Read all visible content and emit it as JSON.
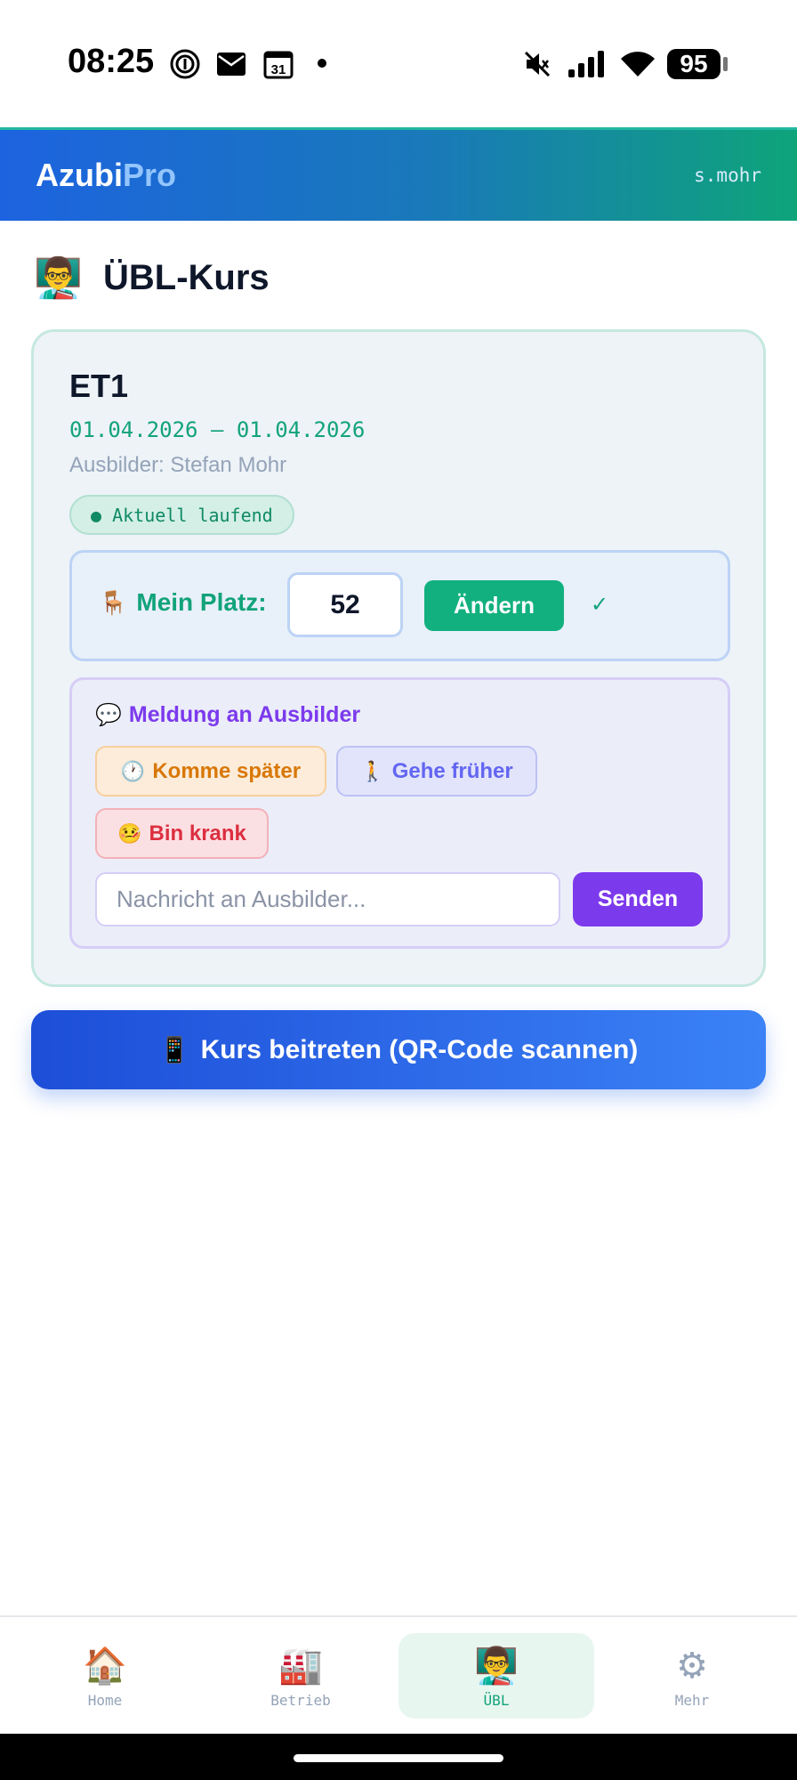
{
  "status_bar": {
    "time": "08:25",
    "calendar_day": "31",
    "battery": "95"
  },
  "header": {
    "brand_main": "Azubi",
    "brand_accent": "Pro",
    "username": "s.mohr"
  },
  "page": {
    "title_emoji": "👨‍🏫",
    "title": "ÜBL-Kurs"
  },
  "course": {
    "name": "ET1",
    "dates": "01.04.2026 – 01.04.2026",
    "trainer": "Ausbilder: Stefan Mohr",
    "status": "● Aktuell laufend",
    "seat": {
      "emoji": "🪑",
      "label": "Mein Platz:",
      "value": "52",
      "change_label": "Ändern",
      "check": "✓"
    },
    "message": {
      "emoji": "💬",
      "title": "Meldung an Ausbilder",
      "quick_late": {
        "emoji": "🕐",
        "label": "Komme später"
      },
      "quick_early": {
        "emoji": "🚶",
        "label": "Gehe früher"
      },
      "quick_sick": {
        "emoji": "🤒",
        "label": "Bin krank"
      },
      "placeholder": "Nachricht an Ausbilder...",
      "send_label": "Senden"
    }
  },
  "join": {
    "emoji": "📱",
    "label": "Kurs beitreten (QR-Code scannen)"
  },
  "nav": {
    "items": [
      {
        "emoji": "🏠",
        "label": "Home"
      },
      {
        "emoji": "🏭",
        "label": "Betrieb"
      },
      {
        "emoji": "👨‍🏫",
        "label": "ÜBL"
      },
      {
        "emoji": "⚙",
        "label": "Mehr"
      }
    ],
    "active": "ÜBL"
  },
  "colors": {
    "accent_green": "#12a37a",
    "accent_purple": "#7c3aed",
    "header_blue": "#1d63e0",
    "header_teal": "#0ea47a"
  }
}
